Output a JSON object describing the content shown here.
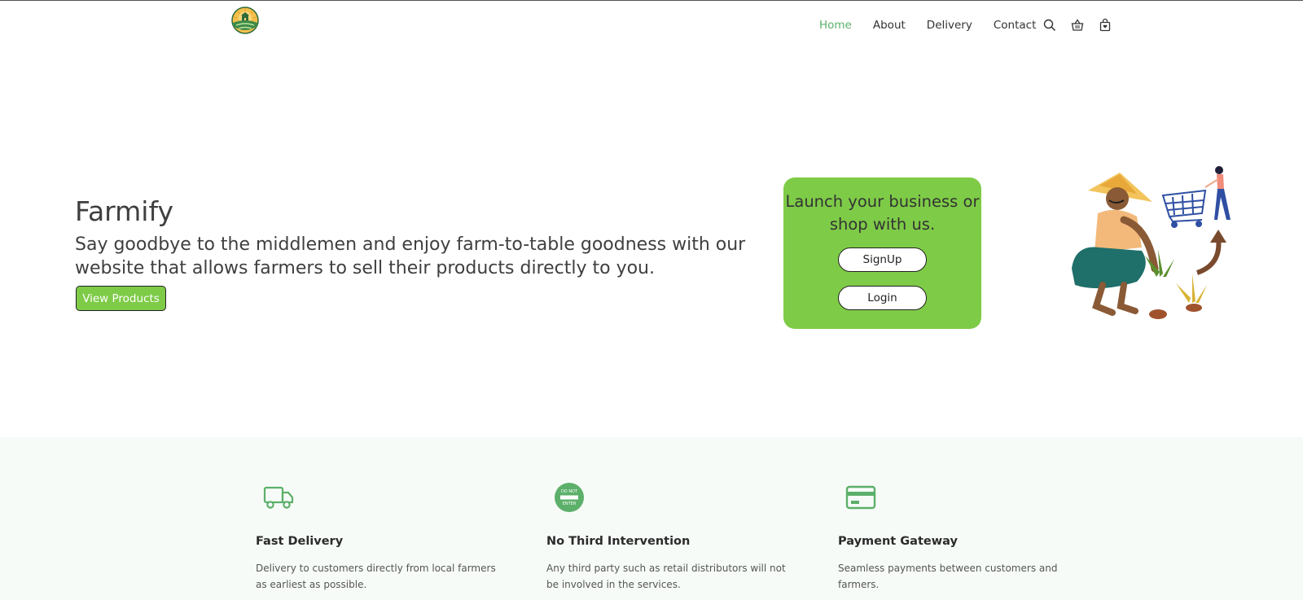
{
  "header": {
    "logo_icon": "farm-sunrise-logo",
    "nav": [
      {
        "label": "Home",
        "active": true
      },
      {
        "label": "About",
        "active": false
      },
      {
        "label": "Delivery",
        "active": false
      },
      {
        "label": "Contact",
        "active": false
      }
    ],
    "icons": [
      "search-icon",
      "basket-icon",
      "bag-icon"
    ],
    "accent_color": "#5cb06a"
  },
  "hero": {
    "title": "Farmify",
    "subtitle": "Say goodbye to the middlemen and enjoy farm-to-table goodness with our website that allows farmers to sell their products directly to you.",
    "cta_label": "View Products",
    "cta_color": "#7ecb47",
    "launch": {
      "text": "Launch your business or shop with us.",
      "signup_label": "SignUp",
      "login_label": "Login",
      "box_color": "#7ecb47"
    },
    "illustration": "farmer-and-shopper-illustration"
  },
  "features": [
    {
      "icon": "truck-icon",
      "title": "Fast Delivery",
      "desc": "Delivery to customers directly from local farmers as earliest as possible."
    },
    {
      "icon": "do-not-enter-icon",
      "title": "No Third Intervention",
      "desc": "Any third party such as retail distributors will not be involved in the services."
    },
    {
      "icon": "credit-card-icon",
      "title": "Payment Gateway",
      "desc": "Seamless payments between customers and farmers."
    }
  ],
  "colors": {
    "feature_bg": "#f7fbf7",
    "icon_green": "#5cb06a"
  }
}
